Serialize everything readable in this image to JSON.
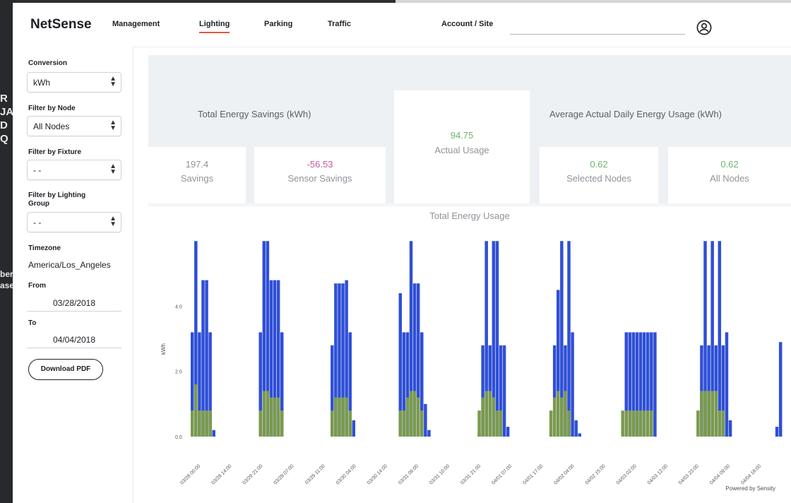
{
  "nav": {
    "logo": "NetSense",
    "links": [
      "Management",
      "Lighting",
      "Parking",
      "Traffic"
    ],
    "active": "Lighting",
    "account_label": "Account / Site",
    "account_value": ""
  },
  "sidebar": {
    "conversion_label": "Conversion",
    "conversion_value": "kWh",
    "node_label": "Filter by Node",
    "node_value": "All Nodes",
    "fixture_label": "Filter by Fixture",
    "fixture_value": "- -",
    "group_label_1": "Filter by Lighting",
    "group_label_2": "Group",
    "group_value": "- -",
    "timezone_label": "Timezone",
    "timezone_value": "America/Los_Angeles",
    "from_label": "From",
    "from_value": "03/28/2018",
    "to_label": "To",
    "to_value": "04/04/2018",
    "download_button": "Download PDF"
  },
  "summary": {
    "total_savings_title": "Total Energy Savings (kWh)",
    "savings_value": "197.4",
    "savings_label": "Savings",
    "sensor_savings_value": "-56.53",
    "sensor_savings_label": "Sensor Savings",
    "actual_usage_value": "94.75",
    "actual_usage_label": "Actual Usage",
    "avg_title": "Average Actual Daily Energy Usage (kWh)",
    "selected_value": "0.62",
    "selected_label": "Selected Nodes",
    "all_value": "0.62",
    "all_label": "All Nodes"
  },
  "colors": {
    "accent": "#e05a3a",
    "green_value": "#6db36d",
    "pink_value": "#c45a9e",
    "bar_blue": "#2f4fd6",
    "bar_green": "#7a9a4e"
  },
  "chart_data": {
    "type": "bar",
    "title": "Total Energy Usage",
    "ylabel": "kWh",
    "yticks": [
      "0.0",
      "2.0",
      "4.0"
    ],
    "ylim": [
      0,
      6.2
    ],
    "xtick_labels": [
      "03/28 00:00",
      "03/28 14:00",
      "03/29 21:00",
      "03/29 07:00",
      "03/29 11:00",
      "03/30 04:00",
      "03/30 14:00",
      "03/31 06:00",
      "03/31 10:00",
      "03/31 21:00",
      "04/01 07:00",
      "04/01 17:00",
      "04/02 04:00",
      "04/02 15:00",
      "04/03 02:00",
      "04/03 12:00",
      "04/03 23:00",
      "04/04 09:00",
      "04/04 18:00"
    ],
    "series": [
      {
        "name": "",
        "values": [
          3.2,
          6.0,
          3.2,
          4.8,
          4.8,
          3.2,
          0.2,
          0,
          0,
          0,
          0,
          0,
          0,
          0,
          0,
          0,
          0,
          0,
          0,
          3.2,
          6.0,
          6.0,
          4.8,
          4.8,
          4.8,
          3.2,
          0,
          0,
          0,
          0,
          0,
          0,
          0,
          0,
          0,
          0,
          0,
          0,
          0,
          2.8,
          4.7,
          4.7,
          4.7,
          4.8,
          3.2,
          0.5,
          0,
          0,
          0,
          0,
          0,
          0,
          0,
          0,
          0,
          0,
          0,
          0,
          4.4,
          3.2,
          3.2,
          6.0,
          4.7,
          4.7,
          3.2,
          1.0,
          0.2,
          0,
          0,
          0,
          0,
          0,
          0,
          0,
          0,
          0,
          0,
          0,
          0,
          0,
          0.1,
          2.8,
          6.0,
          2.8,
          6.0,
          6.0,
          2.8,
          2.8,
          0.3,
          0,
          0,
          0,
          0,
          0,
          0,
          0,
          0,
          0,
          0,
          0,
          0,
          2.8,
          4.5,
          6.0,
          2.8,
          6.0,
          3.2,
          0.5,
          0.1,
          0,
          0,
          0,
          0,
          0,
          0,
          0,
          0,
          0,
          0,
          0,
          0,
          3.2,
          3.2,
          3.2,
          3.2,
          3.2,
          3.2,
          3.2,
          3.2,
          3.2,
          0,
          0,
          0,
          0,
          0,
          0,
          0,
          0,
          0,
          0,
          0,
          0,
          2.8,
          6.0,
          2.8,
          6.0,
          2.8,
          6.0,
          2.8,
          3.2,
          0.5,
          0,
          0,
          0,
          0,
          0,
          0,
          0,
          0,
          0,
          0,
          0,
          0,
          0.3,
          2.9
        ]
      },
      {
        "name": "",
        "values": [
          0.8,
          1.6,
          0.8,
          0.8,
          0.8,
          0.8,
          0,
          0,
          0,
          0,
          0,
          0,
          0,
          0,
          0,
          0,
          0,
          0,
          0,
          0.8,
          1.4,
          1.4,
          1.2,
          1.2,
          1.2,
          0.8,
          0,
          0,
          0,
          0,
          0,
          0,
          0,
          0,
          0,
          0,
          0,
          0,
          0,
          0.8,
          1.2,
          1.2,
          1.2,
          1.2,
          0.8,
          0,
          0,
          0,
          0,
          0,
          0,
          0,
          0,
          0,
          0,
          0,
          0,
          0,
          0.8,
          0.8,
          1.2,
          1.4,
          1.4,
          1.2,
          0.8,
          0,
          0,
          0,
          0,
          0,
          0,
          0,
          0,
          0,
          0,
          0,
          0,
          0,
          0,
          0,
          0.8,
          1.2,
          1.4,
          1.4,
          1.2,
          0.8,
          0.8,
          0,
          0,
          0,
          0,
          0,
          0,
          0,
          0,
          0,
          0,
          0,
          0,
          0,
          0.8,
          1.2,
          1.4,
          1.2,
          1.4,
          0.8,
          0,
          0,
          0,
          0,
          0,
          0,
          0,
          0,
          0,
          0,
          0,
          0,
          0,
          0,
          0.8,
          0.8,
          0.8,
          0.8,
          0.8,
          0.8,
          0.8,
          0.8,
          0.8,
          0,
          0,
          0,
          0,
          0,
          0,
          0,
          0,
          0,
          0,
          0,
          0,
          0.8,
          1.4,
          1.4,
          1.4,
          1.4,
          1.4,
          0.8,
          0.8,
          0,
          0,
          0,
          0,
          0,
          0,
          0,
          0,
          0,
          0,
          0,
          0,
          0,
          0,
          0
        ]
      }
    ]
  },
  "footer": {
    "powered_by": "Powered by Sensity"
  },
  "background_text": {
    "left_block_1": "R JA D Q",
    "left_block_2": "ber ase"
  }
}
